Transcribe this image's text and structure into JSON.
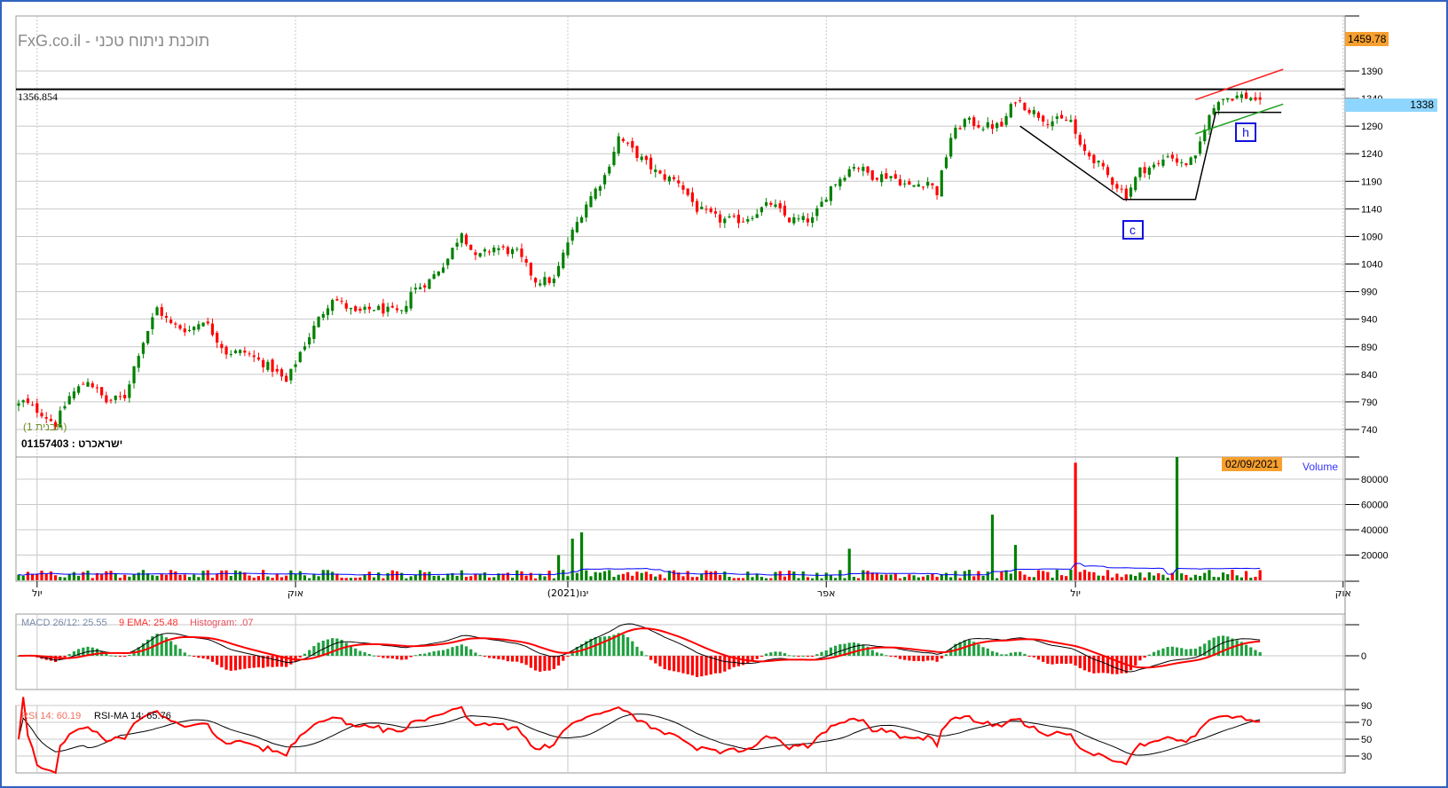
{
  "header": {
    "title": "FxG.co.il - תוכנת ניתוח טכני",
    "symbol_label": "01157403 : ישראכרט",
    "pattern_label": "(תבנית 1)",
    "hline_value": "1356.854",
    "max_price_tag": "1459.78",
    "last_price_tag": "1338",
    "date_tag": "02/09/2021",
    "volume_label": "Volume"
  },
  "indicators": {
    "macd_label": "MACD 26/12: 25.55",
    "ema_label": "9 EMA: 25.48",
    "hist_label": "Histogram: .07",
    "rsi_label": "RSI 14: 60.19",
    "rsima_label": "RSI-MA 14: 65.76"
  },
  "annotations": {
    "c_label": "c",
    "h_label": "h"
  },
  "colors": {
    "up": "#008000",
    "down": "#ff0000",
    "grid": "#c8c8c8",
    "volume_ma": "#0000ff",
    "frame": "#2f63c0",
    "tag": "#f7a030",
    "last_tag": "#8fd6ff"
  },
  "chart_data": {
    "type": "candlestick",
    "title": "FxG.co.il - תוכנת ניתוח טכני",
    "total_days": 288,
    "price_anchors": [
      [
        0,
        785
      ],
      [
        1,
        790
      ],
      [
        5,
        770
      ],
      [
        8,
        750
      ],
      [
        11,
        800
      ],
      [
        15,
        830
      ],
      [
        19,
        790
      ],
      [
        23,
        800
      ],
      [
        26,
        880
      ],
      [
        30,
        960
      ],
      [
        33,
        930
      ],
      [
        37,
        920
      ],
      [
        40,
        940
      ],
      [
        45,
        880
      ],
      [
        49,
        880
      ],
      [
        55,
        850
      ],
      [
        58,
        825
      ],
      [
        61,
        880
      ],
      [
        65,
        940
      ],
      [
        68,
        980
      ],
      [
        73,
        950
      ],
      [
        77,
        960
      ],
      [
        83,
        950
      ],
      [
        85,
        990
      ],
      [
        89,
        1010
      ],
      [
        93,
        1050
      ],
      [
        96,
        1100
      ],
      [
        99,
        1050
      ],
      [
        103,
        1070
      ],
      [
        108,
        1060
      ],
      [
        112,
        1010
      ],
      [
        116,
        1010
      ],
      [
        119,
        1080
      ],
      [
        123,
        1150
      ],
      [
        127,
        1200
      ],
      [
        130,
        1270
      ],
      [
        135,
        1230
      ],
      [
        139,
        1200
      ],
      [
        143,
        1190
      ],
      [
        147,
        1140
      ],
      [
        152,
        1120
      ],
      [
        157,
        1120
      ],
      [
        163,
        1150
      ],
      [
        167,
        1120
      ],
      [
        172,
        1120
      ],
      [
        176,
        1180
      ],
      [
        181,
        1220
      ],
      [
        185,
        1200
      ],
      [
        189,
        1200
      ],
      [
        193,
        1180
      ],
      [
        197,
        1190
      ],
      [
        199,
        1170
      ],
      [
        202,
        1270
      ],
      [
        205,
        1300
      ],
      [
        209,
        1290
      ],
      [
        213,
        1290
      ],
      [
        216,
        1340
      ],
      [
        219,
        1320
      ],
      [
        223,
        1300
      ],
      [
        228,
        1300
      ],
      [
        230,
        1250
      ],
      [
        233,
        1230
      ],
      [
        237,
        1190
      ],
      [
        240,
        1165
      ],
      [
        243,
        1210
      ],
      [
        247,
        1220
      ],
      [
        249,
        1240
      ],
      [
        252,
        1220
      ],
      [
        255,
        1230
      ],
      [
        257,
        1290
      ],
      [
        260,
        1340
      ],
      [
        265,
        1345
      ],
      [
        269,
        1338
      ]
    ],
    "y_ticks": [
      1390,
      1340,
      1290,
      1240,
      1190,
      1140,
      1090,
      1040,
      990,
      940,
      890,
      840,
      790,
      740
    ],
    "ylim": [
      740,
      1390
    ],
    "volume_ticks": [
      80000,
      60000,
      40000,
      20000
    ],
    "volume_spikes": [
      [
        117,
        20000,
        "up"
      ],
      [
        120,
        33000,
        "up"
      ],
      [
        122,
        38000,
        "up"
      ],
      [
        180,
        25000,
        "up"
      ],
      [
        211,
        52000,
        "up"
      ],
      [
        216,
        28000,
        "up"
      ],
      [
        229,
        93000,
        "down"
      ],
      [
        251,
        100000,
        "up"
      ]
    ],
    "x_ticks": [
      {
        "day": 4,
        "label": "יול"
      },
      {
        "day": 60,
        "label": "אוק"
      },
      {
        "day": 119,
        "label": "ינו(2021)"
      },
      {
        "day": 175,
        "label": "אפר"
      },
      {
        "day": 229,
        "label": "יול"
      },
      {
        "day": 287,
        "label": "אוק"
      }
    ],
    "macd_ticks": [
      "0"
    ],
    "rsi_ticks": [
      "90",
      "70",
      "50",
      "30"
    ]
  }
}
